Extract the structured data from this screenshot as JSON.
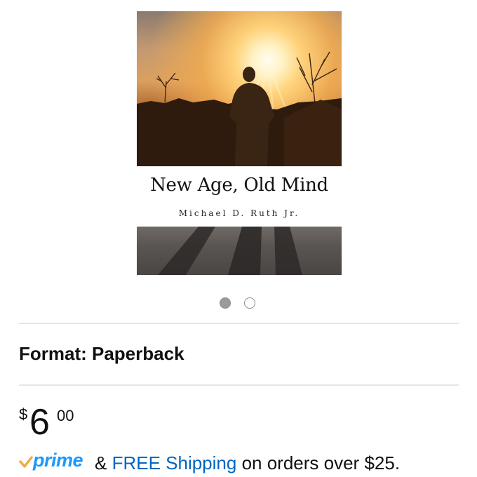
{
  "product": {
    "cover": {
      "title": "New Age, Old Mind",
      "author": "Michael D. Ruth Jr."
    },
    "carousel": {
      "total": 2,
      "active_index": 0
    },
    "format": {
      "label": "Format: Paperback"
    },
    "price": {
      "currency_symbol": "$",
      "whole": "6",
      "fraction": "00"
    },
    "shipping": {
      "prime_logo_text": "prime",
      "ampersand": "&",
      "free_shipping_link": "FREE Shipping",
      "suffix": "on orders over $25."
    }
  },
  "colors": {
    "prime_blue": "#1a98ff",
    "prime_check_orange": "#f3a847",
    "link_blue": "#0066c0",
    "divider": "#e6e6e6",
    "dot_active": "#9b9b9b"
  },
  "icons": {
    "prime_check": "checkmark-icon"
  }
}
